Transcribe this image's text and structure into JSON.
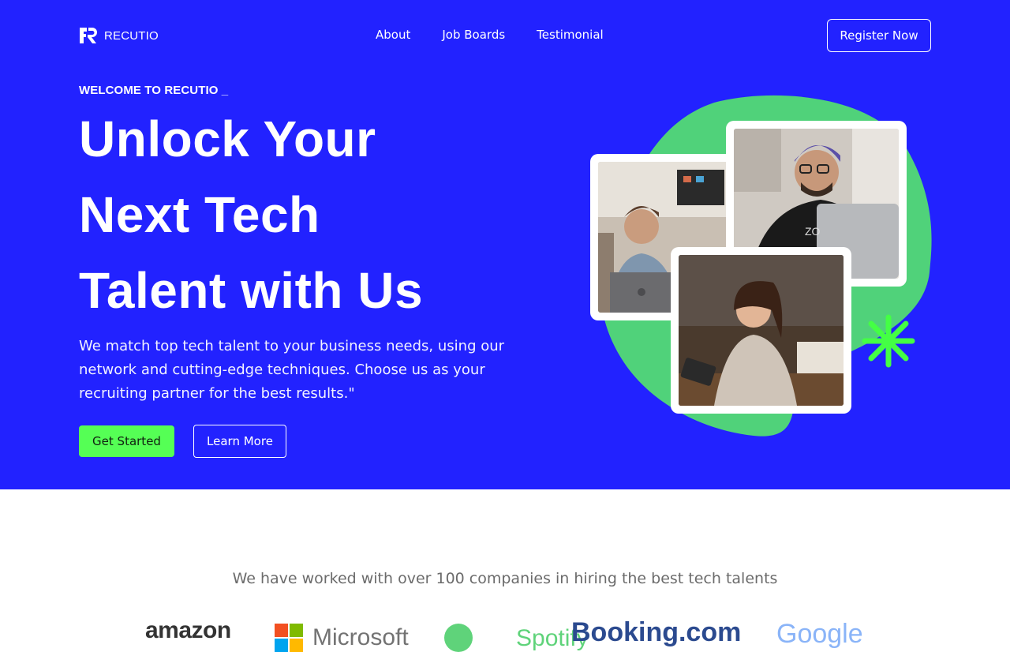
{
  "header": {
    "brand": "RECUTIO",
    "nav": [
      "About",
      "Job Boards",
      "Testimonial"
    ],
    "cta": "Register Now"
  },
  "hero": {
    "eyebrow": "WELCOME TO RECUTIO _",
    "headline": [
      "Unlock Your",
      "Next Tech",
      "Talent with Us"
    ],
    "lead": "We match top tech talent to your business needs, using our network and cutting-edge techniques. Choose us as your recruiting partner for the best results.\"",
    "primary_cta": "Get Started",
    "secondary_cta": "Learn More"
  },
  "companies": {
    "title": "We have worked with over 100 companies in hiring the best tech talents",
    "logos": [
      "amazon",
      "Microsoft",
      "Spotify",
      "Booking.com",
      "Google"
    ]
  },
  "colors": {
    "hero_bg": "#2222ff",
    "accent_green": "#55ff55",
    "blob_green": "#50d27a"
  },
  "icons": [
    "logo-mark-icon",
    "asterisk-icon"
  ]
}
